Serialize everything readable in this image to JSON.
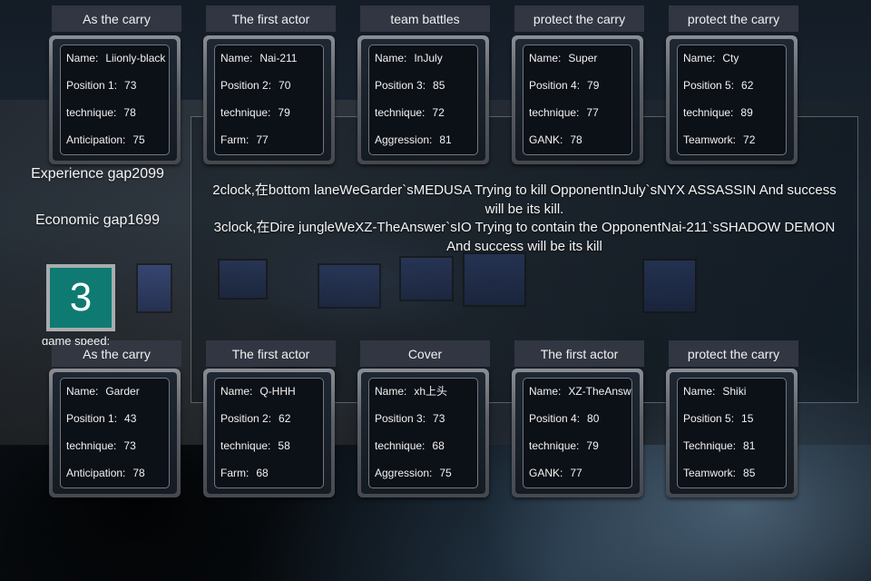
{
  "top_team": [
    {
      "role": "As the carry",
      "stats": [
        {
          "label": "Name:",
          "value": "Liionly-black"
        },
        {
          "label": "Position 1:",
          "value": "73"
        },
        {
          "label": "technique:",
          "value": "78"
        },
        {
          "label": "Anticipation:",
          "value": "75"
        }
      ]
    },
    {
      "role": "The first actor",
      "stats": [
        {
          "label": "Name:",
          "value": "Nai-211"
        },
        {
          "label": "Position 2:",
          "value": "70"
        },
        {
          "label": "technique:",
          "value": "79"
        },
        {
          "label": "Farm:",
          "value": "77"
        }
      ]
    },
    {
      "role": "team battles",
      "stats": [
        {
          "label": "Name:",
          "value": "InJuly"
        },
        {
          "label": "Position 3:",
          "value": "85"
        },
        {
          "label": "technique:",
          "value": "72"
        },
        {
          "label": "Aggression:",
          "value": "81"
        }
      ]
    },
    {
      "role": "protect the carry",
      "stats": [
        {
          "label": "Name:",
          "value": "Super"
        },
        {
          "label": "Position 4:",
          "value": "79"
        },
        {
          "label": "technique:",
          "value": "77"
        },
        {
          "label": "GANK:",
          "value": "78"
        }
      ]
    },
    {
      "role": "protect the carry",
      "stats": [
        {
          "label": "Name:",
          "value": "Cty"
        },
        {
          "label": "Position 5:",
          "value": "62"
        },
        {
          "label": "technique:",
          "value": "89"
        },
        {
          "label": "Teamwork:",
          "value": "72"
        }
      ]
    }
  ],
  "bottom_team": [
    {
      "role": "As the carry",
      "stats": [
        {
          "label": "Name:",
          "value": "Garder"
        },
        {
          "label": "Position 1:",
          "value": "43"
        },
        {
          "label": "technique:",
          "value": "73"
        },
        {
          "label": "Anticipation:",
          "value": "78"
        }
      ]
    },
    {
      "role": "The first actor",
      "stats": [
        {
          "label": "Name:",
          "value": "Q-HHH"
        },
        {
          "label": "Position 2:",
          "value": "62"
        },
        {
          "label": "technique:",
          "value": "58"
        },
        {
          "label": "Farm:",
          "value": "68"
        }
      ]
    },
    {
      "role": "Cover",
      "stats": [
        {
          "label": "Name:",
          "value": "xh上头"
        },
        {
          "label": "Position 3:",
          "value": "73"
        },
        {
          "label": "technique:",
          "value": "68"
        },
        {
          "label": "Aggression:",
          "value": "75"
        }
      ]
    },
    {
      "role": "The first actor",
      "stats": [
        {
          "label": "Name:",
          "value": "XZ-TheAnsw"
        },
        {
          "label": "Position 4:",
          "value": "80"
        },
        {
          "label": "technique:",
          "value": "79"
        },
        {
          "label": "GANK:",
          "value": "77"
        }
      ]
    },
    {
      "role": "protect the carry",
      "stats": [
        {
          "label": "Name:",
          "value": "Shiki"
        },
        {
          "label": "Position 5:",
          "value": "15"
        },
        {
          "label": "Technique:",
          "value": "81"
        },
        {
          "label": "Teamwork:",
          "value": "85"
        }
      ]
    }
  ],
  "summary": {
    "experience_gap": "Experience gap2099",
    "economic_gap": "Economic gap1699"
  },
  "game_speed": {
    "value": "3",
    "label": "game speed:"
  },
  "events": [
    "2clock,在bottom laneWeGarder`sMEDUSA Trying to kill OpponentInJuly`sNYX ASSASSIN And success will be its kill.",
    "3clock,在Dire jungleWeXZ-TheAnswer`sIO Trying to contain the OpponentNai-211`sSHADOW DEMON And success will be its kill"
  ],
  "colors": {
    "speed_box": "#0e7a72",
    "tab_bg": "#343844"
  }
}
